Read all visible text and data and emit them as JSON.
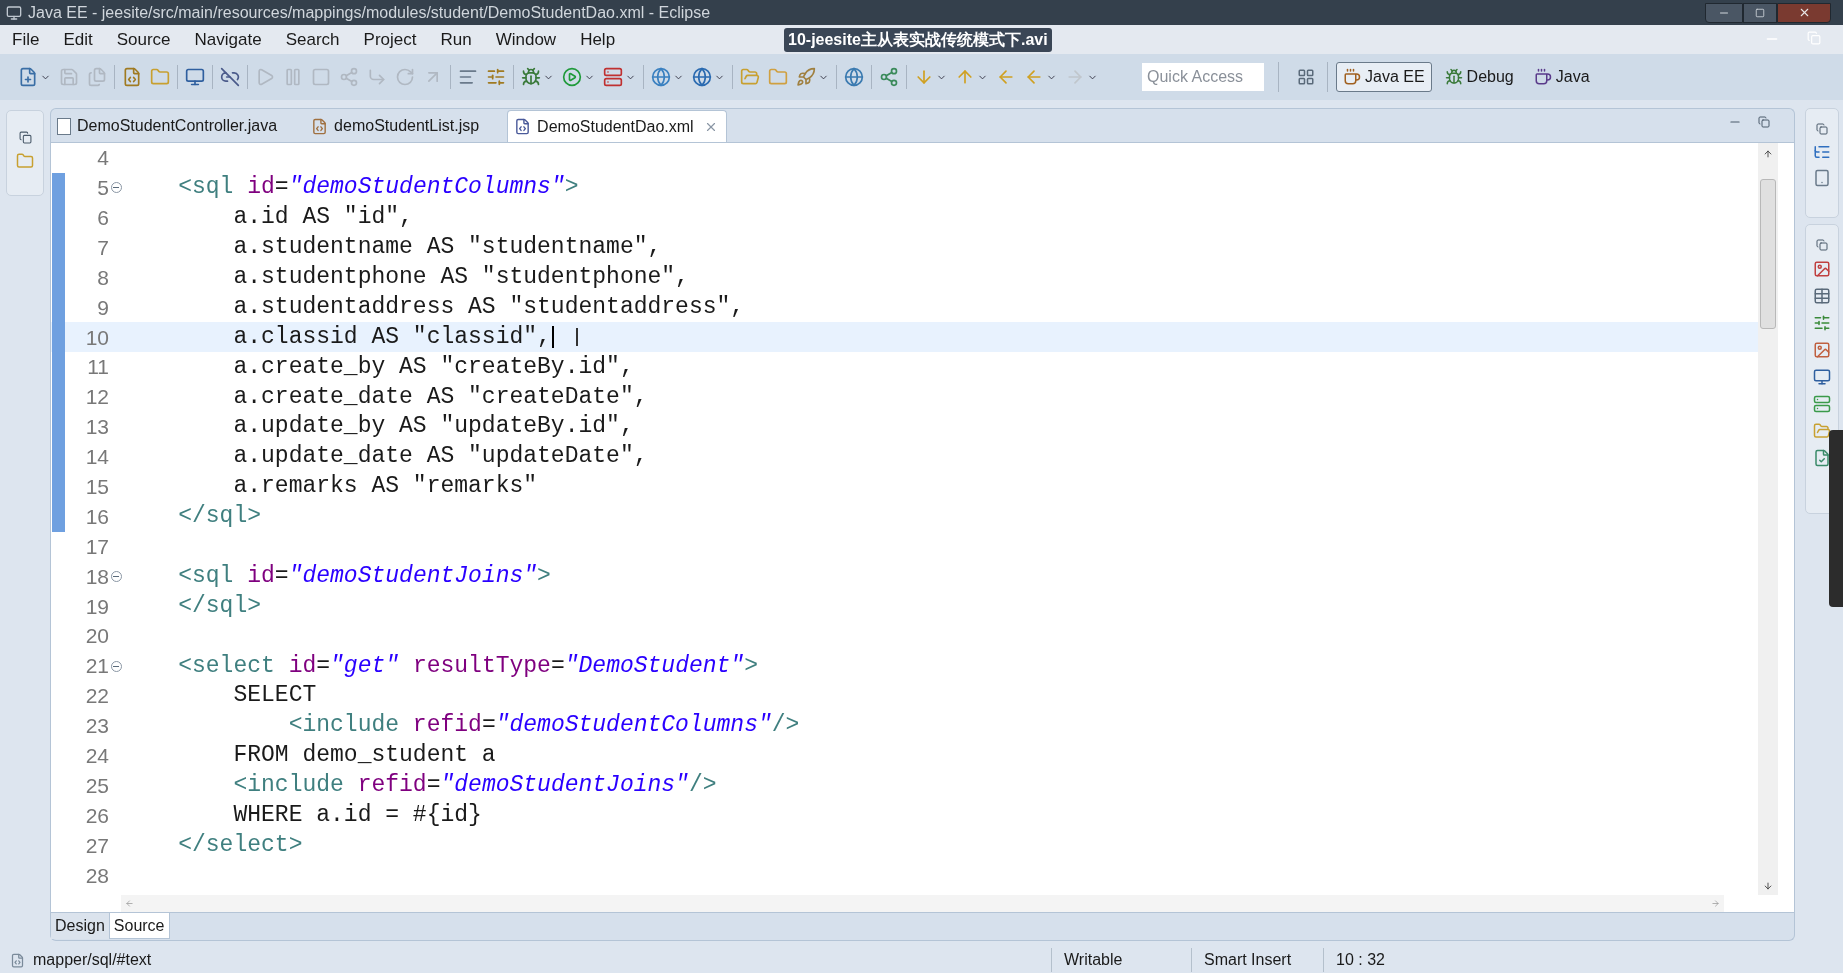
{
  "window": {
    "title": "Java EE - jeesite/src/main/resources/mappings/modules/student/DemoStudentDao.xml - Eclipse"
  },
  "video_overlay": {
    "title": "10-jeesite主从表实战传统模式下.avi"
  },
  "menu": [
    "File",
    "Edit",
    "Source",
    "Navigate",
    "Search",
    "Project",
    "Run",
    "Window",
    "Help"
  ],
  "toolbar": {
    "quick_access": {
      "placeholder": "Quick Access"
    },
    "perspectives": [
      {
        "label": "Java EE",
        "kind": "javaee",
        "selected": true
      },
      {
        "label": "Debug",
        "kind": "debug",
        "selected": false
      },
      {
        "label": "Java",
        "kind": "java",
        "selected": false
      }
    ]
  },
  "editor_tabs": [
    {
      "label": "DemoStudentController.java",
      "kind": "java",
      "selected": false
    },
    {
      "label": "demoStudentList.jsp",
      "kind": "jsp",
      "selected": false
    },
    {
      "label": "DemoStudentDao.xml",
      "kind": "xml",
      "selected": true
    }
  ],
  "editor": {
    "lines": [
      {
        "number": "4",
        "current": false,
        "changed": false
      },
      {
        "number": "5",
        "current": false,
        "changed": true,
        "fold_expanded": true,
        "tokens": [
          {
            "kind": "tag",
            "text": "    <sql "
          },
          {
            "kind": "attr",
            "text": "id"
          },
          {
            "kind": "text",
            "text": "="
          },
          {
            "kind": "value",
            "text": "\"demoStudentColumns\""
          },
          {
            "kind": "tag",
            "text": ">"
          }
        ]
      },
      {
        "number": "6",
        "current": false,
        "changed": true,
        "tokens": [
          {
            "kind": "text",
            "text": "        a.id AS \"id\","
          }
        ]
      },
      {
        "number": "7",
        "current": false,
        "changed": true,
        "tokens": [
          {
            "kind": "text",
            "text": "        a.studentname AS \"studentname\","
          }
        ]
      },
      {
        "number": "8",
        "current": false,
        "changed": true,
        "tokens": [
          {
            "kind": "text",
            "text": "        a.studentphone AS \"studentphone\","
          }
        ]
      },
      {
        "number": "9",
        "current": false,
        "changed": true,
        "tokens": [
          {
            "kind": "text",
            "text": "        a.studentaddress AS \"studentaddress\","
          }
        ]
      },
      {
        "number": "10",
        "current": true,
        "changed": true,
        "tokens": [
          {
            "kind": "text",
            "text": "        a.classid AS \"classid\","
          }
        ]
      },
      {
        "number": "11",
        "current": false,
        "changed": true,
        "tokens": [
          {
            "kind": "text",
            "text": "        a.create_by AS \"createBy.id\","
          }
        ]
      },
      {
        "number": "12",
        "current": false,
        "changed": true,
        "tokens": [
          {
            "kind": "text",
            "text": "        a.create_date AS \"createDate\","
          }
        ]
      },
      {
        "number": "13",
        "current": false,
        "changed": true,
        "tokens": [
          {
            "kind": "text",
            "text": "        a.update_by AS \"updateBy.id\","
          }
        ]
      },
      {
        "number": "14",
        "current": false,
        "changed": true,
        "tokens": [
          {
            "kind": "text",
            "text": "        a.update_date AS \"updateDate\","
          }
        ]
      },
      {
        "number": "15",
        "current": false,
        "changed": true,
        "tokens": [
          {
            "kind": "text",
            "text": "        a.remarks AS \"remarks\""
          }
        ]
      },
      {
        "number": "16",
        "current": false,
        "changed": true,
        "tokens": [
          {
            "kind": "tag",
            "text": "    </sql>"
          }
        ]
      },
      {
        "number": "17",
        "current": false,
        "changed": false
      },
      {
        "number": "18",
        "current": false,
        "changed": false,
        "fold_expanded": true,
        "tokens": [
          {
            "kind": "tag",
            "text": "    <sql "
          },
          {
            "kind": "attr",
            "text": "id"
          },
          {
            "kind": "text",
            "text": "="
          },
          {
            "kind": "value",
            "text": "\"demoStudentJoins\""
          },
          {
            "kind": "tag",
            "text": ">"
          }
        ]
      },
      {
        "number": "19",
        "current": false,
        "changed": false,
        "tokens": [
          {
            "kind": "tag",
            "text": "    </sql>"
          }
        ]
      },
      {
        "number": "20",
        "current": false,
        "changed": false
      },
      {
        "number": "21",
        "current": false,
        "changed": false,
        "fold_expanded": true,
        "tokens": [
          {
            "kind": "tag",
            "text": "    <select "
          },
          {
            "kind": "attr",
            "text": "id"
          },
          {
            "kind": "text",
            "text": "="
          },
          {
            "kind": "value",
            "text": "\"get\""
          },
          {
            "kind": "attr",
            "text": " resultType"
          },
          {
            "kind": "text",
            "text": "="
          },
          {
            "kind": "value",
            "text": "\"DemoStudent\""
          },
          {
            "kind": "tag",
            "text": ">"
          }
        ]
      },
      {
        "number": "22",
        "current": false,
        "changed": false,
        "tokens": [
          {
            "kind": "text",
            "text": "        SELECT"
          }
        ]
      },
      {
        "number": "23",
        "current": false,
        "changed": false,
        "tokens": [
          {
            "kind": "tag",
            "text": "            <include "
          },
          {
            "kind": "attr",
            "text": "refid"
          },
          {
            "kind": "text",
            "text": "="
          },
          {
            "kind": "value",
            "text": "\"demoStudentColumns\""
          },
          {
            "kind": "tag",
            "text": "/>"
          }
        ]
      },
      {
        "number": "24",
        "current": false,
        "changed": false,
        "tokens": [
          {
            "kind": "text",
            "text": "        FROM demo_student a"
          }
        ]
      },
      {
        "number": "25",
        "current": false,
        "changed": false,
        "tokens": [
          {
            "kind": "tag",
            "text": "        <include "
          },
          {
            "kind": "attr",
            "text": "refid"
          },
          {
            "kind": "text",
            "text": "="
          },
          {
            "kind": "value",
            "text": "\"demoStudentJoins\""
          },
          {
            "kind": "tag",
            "text": "/>"
          }
        ]
      },
      {
        "number": "26",
        "current": false,
        "changed": false,
        "tokens": [
          {
            "kind": "text",
            "text": "        WHERE a.id = #{id}"
          }
        ]
      },
      {
        "number": "27",
        "current": false,
        "changed": false,
        "tokens": [
          {
            "kind": "tag",
            "text": "    </select>"
          }
        ]
      },
      {
        "number": "28",
        "current": false,
        "changed": false
      }
    ]
  },
  "bottom_tabs": [
    {
      "label": "Design",
      "selected": false
    },
    {
      "label": "Source",
      "selected": true
    }
  ],
  "status_bar": {
    "path": "mapper/sql/#text",
    "mode": "Writable",
    "insert": "Smart Insert",
    "position": "10 : 32"
  }
}
